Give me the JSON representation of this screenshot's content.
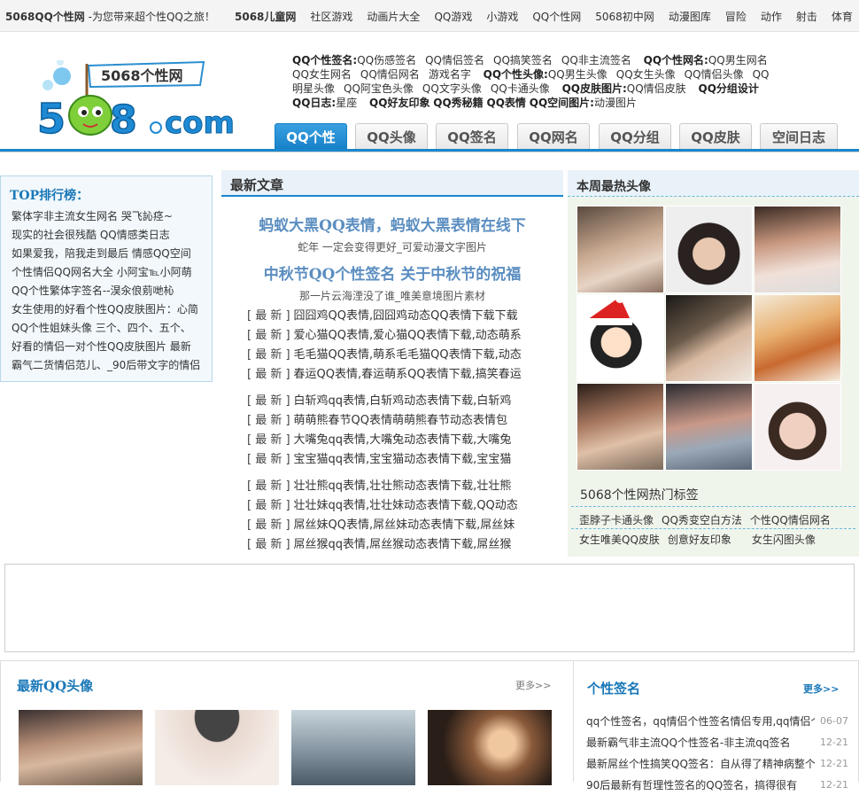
{
  "topbar": {
    "slogan_prefix": "5068QQ个性网",
    "slogan_rest": " -为您带来超个性QQ之旅！",
    "nav": [
      "5068儿童网",
      "社区游戏",
      "动画片大全",
      "QQ游戏",
      "小游戏",
      "QQ个性网",
      "5068初中网",
      "动漫图库",
      "冒险",
      "动作",
      "射击",
      "体育"
    ]
  },
  "logo": {
    "text": "5068个性网",
    "domain": "5068.com"
  },
  "header_links": [
    {
      "k": "QQ个性签名:",
      "v": [
        "QQ伤感签名",
        "QQ情侣签名",
        "QQ搞笑签名",
        "QQ非主流签名"
      ]
    },
    {
      "k": "QQ个性网名:",
      "v": [
        "QQ男生网名",
        "QQ女生网名",
        "QQ情侣网名",
        "游戏名字"
      ]
    },
    {
      "k": "QQ个性头像:",
      "v": [
        "QQ男生头像",
        "QQ女生头像",
        "QQ情侣头像",
        "QQ明星头像",
        "QQ阿宝色头像",
        "QQ文字头像",
        "QQ卡通头像"
      ]
    },
    {
      "k": "QQ皮肤图片:",
      "v": [
        "QQ情侣皮肤"
      ]
    },
    {
      "k": "QQ分组设计",
      "v": []
    },
    {
      "k": "QQ日志:",
      "v": [
        "星座"
      ]
    },
    {
      "k": "QQ好友印象",
      "v": []
    },
    {
      "k": "QQ秀秘籍",
      "v": []
    },
    {
      "k": "QQ表情",
      "v": []
    },
    {
      "k": "QQ空间图片:",
      "v": [
        "动漫图片"
      ]
    }
  ],
  "tabs": [
    "QQ个性",
    "QQ头像",
    "QQ签名",
    "QQ网名",
    "QQ分组",
    "QQ皮肤",
    "空间日志"
  ],
  "rank": {
    "title": "TOP排行榜：",
    "items": [
      "繁体字非主流女生网名 哭飞訫痉~",
      "现实的社会很残酷 QQ情感类日志",
      "如果爱我，陪我走到最后 情感QQ空间",
      "个性情侣QQ网名大全 小阿宝℡小阿萌",
      "QQ个性繁体字签名--淏汆俍莂哋杺",
      "女生使用的好看个性QQ皮肤图片：心简",
      "QQ个性姐妹头像 三个、四个、五个、",
      "好看的情侣一对个性QQ皮肤图片 最新",
      "霸气二货情侣范儿、_90后带文字的情侣"
    ]
  },
  "news": {
    "title": "最新文章",
    "headlines": [
      {
        "title": "蚂蚁大黑QQ表情，蚂蚁大黑表情在线下",
        "sub": "蛇年 一定会变得更好_可爱动漫文字图片"
      },
      {
        "title": "中秋节QQ个性签名 关于中秋节的祝福",
        "sub": "那一片云海湮没了谁_唯美意境图片素材"
      }
    ],
    "tag": "[ 最 新 ]",
    "groups": [
      [
        "囧囧鸡QQ表情,囧囧鸡动态QQ表情下载下载",
        "爱心猫QQ表情,爱心猫QQ表情下载,动态萌系",
        "毛毛猫QQ表情,萌系毛毛猫QQ表情下载,动态",
        "春运QQ表情,春运萌系QQ表情下载,搞笑春运"
      ],
      [
        "白斩鸡qq表情,白斩鸡动态表情下载,白斩鸡",
        "萌萌熊春节QQ表情萌萌熊春节动态表情包",
        "大嘴兔qq表情,大嘴兔动态表情下载,大嘴兔",
        "宝宝猫qq表情,宝宝猫动态表情下载,宝宝猫"
      ],
      [
        "壮壮熊qq表情,壮壮熊动态表情下载,壮壮熊",
        "壮壮妹qq表情,壮壮妹动态表情下载,QQ动态",
        "屌丝妹QQ表情,屌丝妹动态表情下载,屌丝妹",
        "屌丝猴qq表情,屌丝猴动态表情下载,屌丝猴"
      ]
    ]
  },
  "hot": {
    "title": "本周最热头像",
    "tags_title": "5068个性网热门标签",
    "tags_row1": [
      "歪脖子卡通头像",
      "QQ秀变空白方法",
      "个性QQ情侣网名"
    ],
    "tags_row2": [
      "女生唯美QQ皮肤",
      "创意好友印象",
      "女生闪图头像"
    ]
  },
  "latest_avatars": {
    "title": "最新QQ头像",
    "more": "更多>>"
  },
  "signatures": {
    "title": "个性签名",
    "more": "更多>>",
    "items": [
      {
        "text": "qq个性签名，qq情侣个性签名情侣专用,qq情侣个",
        "date": "06-07"
      },
      {
        "text": "最新霸气非主流QQ个性签名-非主流qq签名",
        "date": "12-21"
      },
      {
        "text": "最新屌丝个性搞笑QQ签名：自从得了精神病整个",
        "date": "12-21"
      },
      {
        "text": "90后最新有哲理性签名的QQ签名，搞得很有",
        "date": "12-21"
      }
    ]
  },
  "colors": {
    "accent": "#1b86cc",
    "title_blue": "#1a78b8",
    "headline_blue": "#5b8ec0"
  }
}
